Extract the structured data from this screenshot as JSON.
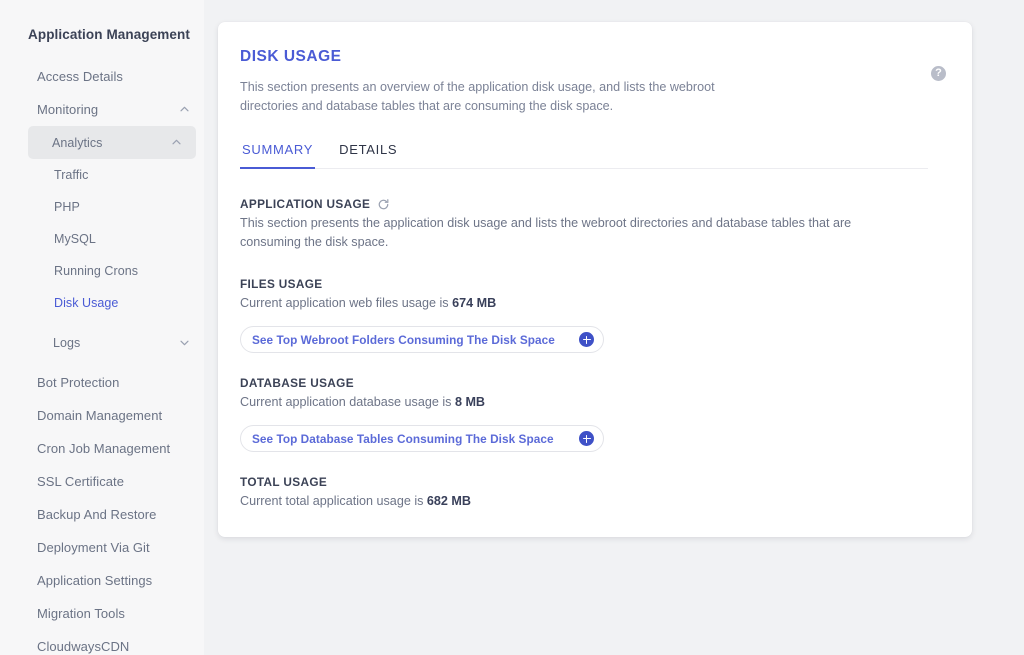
{
  "sidebar": {
    "title": "Application Management",
    "items": [
      {
        "label": "Access Details",
        "level": 1,
        "chevron": "none",
        "state": "normal"
      },
      {
        "label": "Monitoring",
        "level": 1,
        "chevron": "up",
        "state": "normal"
      },
      {
        "label": "Analytics",
        "level": 2,
        "chevron": "up",
        "state": "highlighted"
      },
      {
        "label": "Traffic",
        "level": 3,
        "chevron": "none",
        "state": "normal"
      },
      {
        "label": "PHP",
        "level": 3,
        "chevron": "none",
        "state": "normal"
      },
      {
        "label": "MySQL",
        "level": 3,
        "chevron": "none",
        "state": "normal"
      },
      {
        "label": "Running Crons",
        "level": 3,
        "chevron": "none",
        "state": "normal"
      },
      {
        "label": "Disk Usage",
        "level": 3,
        "chevron": "none",
        "state": "current"
      },
      {
        "label": "Logs",
        "level": 2,
        "chevron": "down",
        "state": "normal"
      },
      {
        "label": "Bot Protection",
        "level": 1,
        "chevron": "none",
        "state": "normal"
      },
      {
        "label": "Domain Management",
        "level": 1,
        "chevron": "none",
        "state": "normal"
      },
      {
        "label": "Cron Job Management",
        "level": 1,
        "chevron": "none",
        "state": "normal"
      },
      {
        "label": "SSL Certificate",
        "level": 1,
        "chevron": "none",
        "state": "normal"
      },
      {
        "label": "Backup And Restore",
        "level": 1,
        "chevron": "none",
        "state": "normal"
      },
      {
        "label": "Deployment Via Git",
        "level": 1,
        "chevron": "none",
        "state": "normal"
      },
      {
        "label": "Application Settings",
        "level": 1,
        "chevron": "none",
        "state": "normal"
      },
      {
        "label": "Migration Tools",
        "level": 1,
        "chevron": "none",
        "state": "normal"
      },
      {
        "label": "CloudwaysCDN",
        "level": 1,
        "chevron": "none",
        "state": "normal"
      }
    ]
  },
  "card": {
    "title": "DISK USAGE",
    "description": "This section presents an overview of the application disk usage, and lists the webroot directories and database tables that are consuming the disk space.",
    "help_icon": "question-mark",
    "help_label": "?",
    "tabs": [
      {
        "label": "SUMMARY",
        "active": true
      },
      {
        "label": "DETAILS",
        "active": false
      }
    ],
    "application_usage": {
      "heading": "APPLICATION USAGE",
      "refresh_icon": "refresh-icon",
      "description": "This section presents the application disk usage and lists the webroot directories and database tables that are consuming the disk space."
    },
    "files_usage": {
      "heading": "FILES USAGE",
      "text_prefix": "Current application web files usage is ",
      "value": "674 MB",
      "button_label": "See Top Webroot Folders Consuming The Disk Space",
      "button_icon": "plus-icon"
    },
    "database_usage": {
      "heading": "DATABASE USAGE",
      "text_prefix": "Current application database usage is ",
      "value": "8 MB",
      "button_label": "See Top Database Tables Consuming The Disk Space",
      "button_icon": "plus-icon"
    },
    "total_usage": {
      "heading": "TOTAL USAGE",
      "text_prefix": "Current total application usage is ",
      "value": "682 MB"
    }
  },
  "colors": {
    "accent": "#4a5bd5",
    "accent_deep": "#3f51c7",
    "page_bg": "#f1f2f4",
    "sidebar_bg": "#f7f7f8",
    "card_bg": "#ffffff",
    "text_muted": "#7b8296",
    "text_dark": "#3b4256",
    "highlight_bg": "#e7e8ea"
  }
}
